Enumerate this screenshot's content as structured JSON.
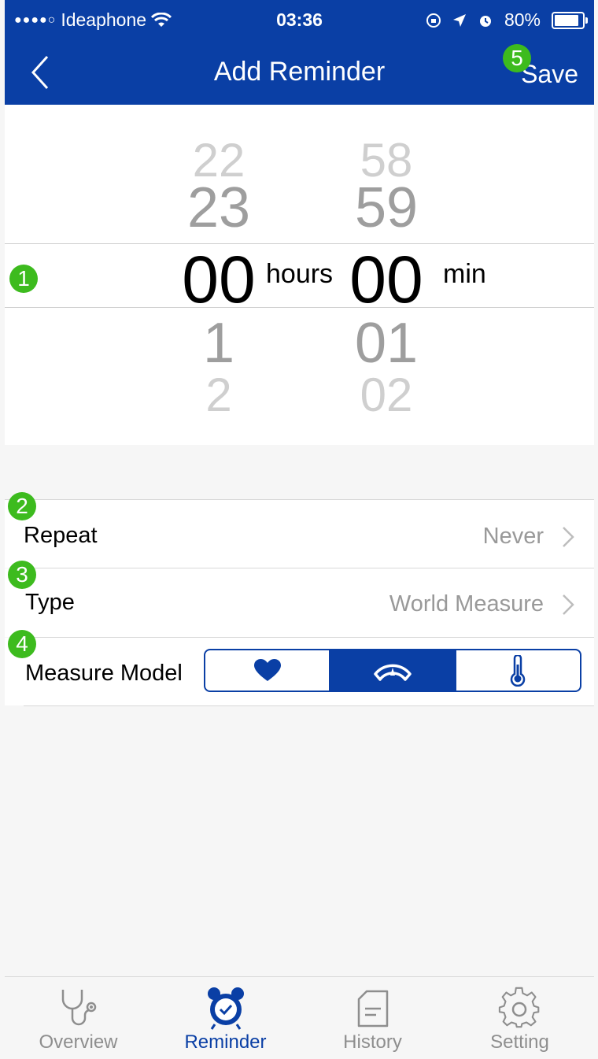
{
  "status_bar": {
    "signal": "●●●●○",
    "carrier": "Ideaphone",
    "time": "03:36",
    "battery": "80%"
  },
  "nav": {
    "title": "Add Reminder",
    "save_label": "Save"
  },
  "badges": {
    "picker": "1",
    "repeat": "2",
    "type": "3",
    "measure_model": "4",
    "save": "5"
  },
  "picker": {
    "hours": {
      "above2": "22",
      "above1": "23",
      "selected": "00",
      "below1": "1",
      "below2": "2"
    },
    "minutes": {
      "above2": "58",
      "above1": "59",
      "selected": "00",
      "below1": "01",
      "below2": "02"
    },
    "hours_label": "hours",
    "minutes_label": "min"
  },
  "repeat": {
    "label": "Repeat",
    "value": "Never"
  },
  "type": {
    "label": "Type",
    "value": "World Measure"
  },
  "measure_model": {
    "label": "Measure Model",
    "options": [
      {
        "icon": "heart-icon",
        "selected": false
      },
      {
        "icon": "gauge-icon",
        "selected": true
      },
      {
        "icon": "thermometer-icon",
        "selected": false
      }
    ]
  },
  "tabs": [
    {
      "label": "Overview",
      "icon": "stethoscope-icon",
      "active": false
    },
    {
      "label": "Reminder",
      "icon": "alarm-clock-icon",
      "active": true
    },
    {
      "label": "History",
      "icon": "document-icon",
      "active": false
    },
    {
      "label": "Setting",
      "icon": "gear-icon",
      "active": false
    }
  ],
  "colors": {
    "primary": "#0a3fa5",
    "badge": "#3dbb1e",
    "secondary_text": "#999999"
  }
}
